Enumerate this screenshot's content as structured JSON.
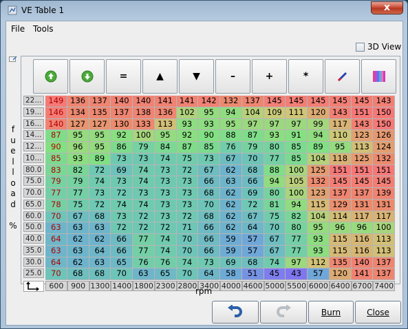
{
  "window": {
    "title": "VE Table 1",
    "close_label": "x"
  },
  "menu": {
    "file": "File",
    "tools": "Tools"
  },
  "view3d_label": "3D View",
  "y_axis_label": [
    "f",
    "u",
    "e",
    "l",
    "l",
    "o",
    "a",
    "d",
    "",
    "%"
  ],
  "x_axis_label": "rpm",
  "toolbar": [
    {
      "name": "increment-icon-button",
      "glyph": "up"
    },
    {
      "name": "decrement-icon-button",
      "glyph": "down"
    },
    {
      "name": "set-equal-button",
      "glyph": "="
    },
    {
      "name": "increase-button",
      "glyph": "▲"
    },
    {
      "name": "decrease-button",
      "glyph": "▼"
    },
    {
      "name": "subtract-button",
      "glyph": "–"
    },
    {
      "name": "add-button",
      "glyph": "+"
    },
    {
      "name": "multiply-button",
      "glyph": "*"
    },
    {
      "name": "interpolate-button",
      "glyph": "pen"
    },
    {
      "name": "colorize-button",
      "glyph": "bars"
    }
  ],
  "table": {
    "row_labels": [
      "22...",
      "19...",
      "16...",
      "14...",
      "12...",
      "10...",
      "80.0",
      "75.0",
      "70.0",
      "65.0",
      "60.0",
      "50.0",
      "40.0",
      "35.0",
      "30.0",
      "25.0"
    ],
    "col_labels": [
      "600",
      "900",
      "1300",
      "1400",
      "1800",
      "2300",
      "2800",
      "3400",
      "4000",
      "4600",
      "5000",
      "5500",
      "6000",
      "6400",
      "6700",
      "7400"
    ],
    "values": [
      [
        149,
        136,
        137,
        140,
        140,
        141,
        141,
        142,
        132,
        137,
        145,
        145,
        145,
        145,
        145,
        143
      ],
      [
        146,
        134,
        135,
        137,
        138,
        136,
        102,
        95,
        94,
        104,
        109,
        111,
        120,
        143,
        151,
        150
      ],
      [
        140,
        127,
        127,
        130,
        133,
        113,
        93,
        93,
        95,
        97,
        97,
        97,
        99,
        117,
        143,
        150
      ],
      [
        87,
        95,
        95,
        92,
        100,
        95,
        92,
        90,
        88,
        87,
        93,
        91,
        94,
        110,
        123,
        126
      ],
      [
        90,
        96,
        95,
        86,
        79,
        84,
        87,
        85,
        76,
        79,
        80,
        85,
        89,
        95,
        113,
        124
      ],
      [
        85,
        93,
        89,
        73,
        73,
        74,
        75,
        73,
        67,
        70,
        77,
        85,
        104,
        118,
        125,
        132
      ],
      [
        83,
        82,
        72,
        69,
        74,
        73,
        72,
        67,
        62,
        68,
        88,
        100,
        125,
        151,
        151,
        151
      ],
      [
        79,
        79,
        74,
        73,
        74,
        73,
        73,
        66,
        63,
        66,
        94,
        105,
        132,
        145,
        145,
        145
      ],
      [
        77,
        77,
        73,
        72,
        73,
        73,
        73,
        68,
        62,
        69,
        80,
        100,
        123,
        137,
        137,
        139
      ],
      [
        78,
        75,
        72,
        74,
        74,
        73,
        73,
        70,
        62,
        72,
        81,
        94,
        115,
        129,
        131,
        131
      ],
      [
        70,
        67,
        68,
        73,
        72,
        73,
        72,
        68,
        62,
        67,
        75,
        82,
        104,
        114,
        117,
        117
      ],
      [
        63,
        63,
        63,
        72,
        72,
        72,
        71,
        66,
        62,
        64,
        70,
        80,
        95,
        96,
        96,
        100
      ],
      [
        64,
        62,
        62,
        66,
        77,
        74,
        70,
        66,
        59,
        57,
        67,
        77,
        93,
        115,
        116,
        113
      ],
      [
        63,
        63,
        64,
        66,
        77,
        74,
        70,
        66,
        59,
        57,
        67,
        77,
        93,
        115,
        116,
        113
      ],
      [
        64,
        62,
        63,
        65,
        76,
        76,
        74,
        73,
        69,
        68,
        74,
        97,
        112,
        135,
        140,
        137
      ],
      [
        70,
        68,
        68,
        70,
        63,
        65,
        70,
        64,
        58,
        51,
        45,
        43,
        57,
        120,
        141,
        137
      ]
    ]
  },
  "footer": {
    "undo_glyph": "undo",
    "redo_glyph": "redo",
    "burn": "Burn",
    "close": "Close"
  }
}
